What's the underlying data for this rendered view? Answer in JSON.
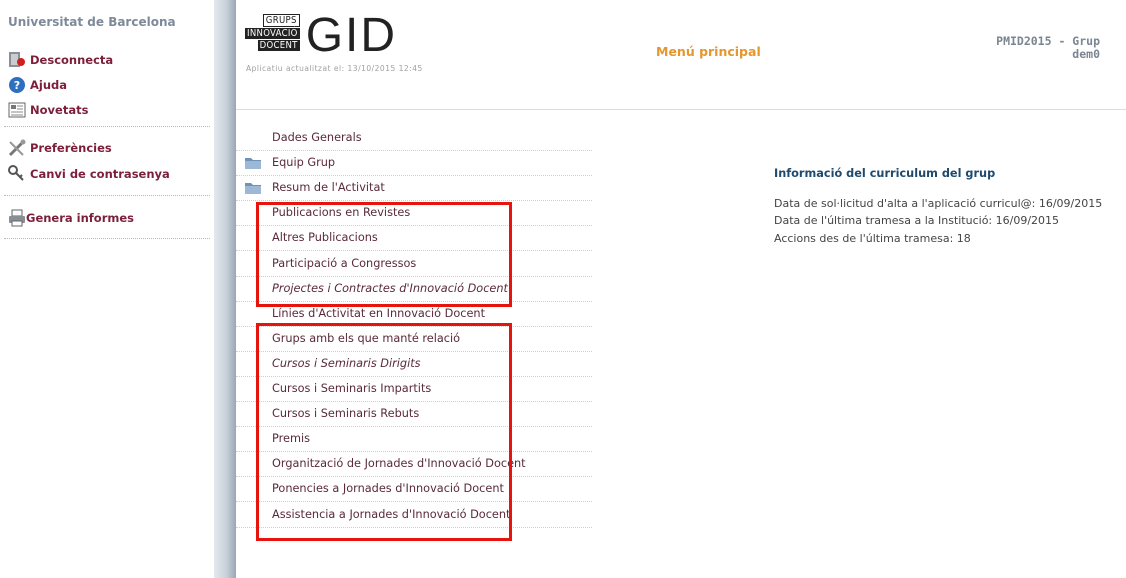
{
  "sidebar": {
    "university": "Universitat de Barcelona",
    "group1": [
      {
        "label": "Desconnecta",
        "icon": "logout-icon"
      },
      {
        "label": "Ajuda",
        "icon": "help-icon"
      },
      {
        "label": "Novetats",
        "icon": "news-icon"
      }
    ],
    "group2": [
      {
        "label": "Preferències",
        "icon": "tools-icon"
      },
      {
        "label": "Canvi de contrasenya",
        "icon": "key-icon"
      }
    ],
    "group3": [
      {
        "label": "Genera informes",
        "icon": "printer-icon"
      }
    ]
  },
  "header": {
    "logo_words": [
      "GRUPS",
      "INNOVACIÓ",
      "DOCENT"
    ],
    "logo_main": "GID",
    "updated": "Aplicatiu actualitzat el: 13/10/2015 12:45",
    "menu_title": "Menú principal",
    "user_line1": "PMID2015 - Grup",
    "user_line2": "dem0"
  },
  "menu": [
    {
      "label": "Dades Generals",
      "folder": false,
      "italic": false
    },
    {
      "label": "Equip Grup",
      "folder": true,
      "italic": false
    },
    {
      "label": "Resum de l'Activitat",
      "folder": true,
      "italic": false
    },
    {
      "label": "Publicacions en Revistes",
      "folder": false,
      "italic": false
    },
    {
      "label": "Altres Publicacions",
      "folder": false,
      "italic": false
    },
    {
      "label": "Participació a Congressos",
      "folder": false,
      "italic": false
    },
    {
      "label": "Projectes i Contractes d'Innovació Docent",
      "folder": false,
      "italic": true
    },
    {
      "label": "Línies d'Activitat en Innovació Docent",
      "folder": false,
      "italic": false
    },
    {
      "label": "Grups amb els que manté relació",
      "folder": false,
      "italic": false
    },
    {
      "label": "Cursos i Seminaris Dirigits",
      "folder": false,
      "italic": true
    },
    {
      "label": "Cursos i Seminaris Impartits",
      "folder": false,
      "italic": false
    },
    {
      "label": "Cursos i Seminaris Rebuts",
      "folder": false,
      "italic": false
    },
    {
      "label": "Premis",
      "folder": false,
      "italic": false
    },
    {
      "label": "Organització de Jornades d'Innovació Docent",
      "folder": false,
      "italic": false
    },
    {
      "label": "Ponencies a Jornades d'Innovació Docent",
      "folder": false,
      "italic": false
    },
    {
      "label": "Assistencia a Jornades d'Innovació Docent",
      "folder": false,
      "italic": false
    }
  ],
  "info": {
    "title": "Informació del curriculum del grup",
    "lines": [
      "Data de sol·licitud d'alta a l'aplicació curricul@: 16/09/2015",
      "Data de l'última tramesa a la Institució: 16/09/2015",
      "Accions des de l'última tramesa: 18"
    ]
  },
  "colors": {
    "sidebar_link": "#7b1f3b",
    "menu_title": "#e3972f",
    "info_title": "#1e4a6e",
    "highlight": "#e6140c"
  }
}
